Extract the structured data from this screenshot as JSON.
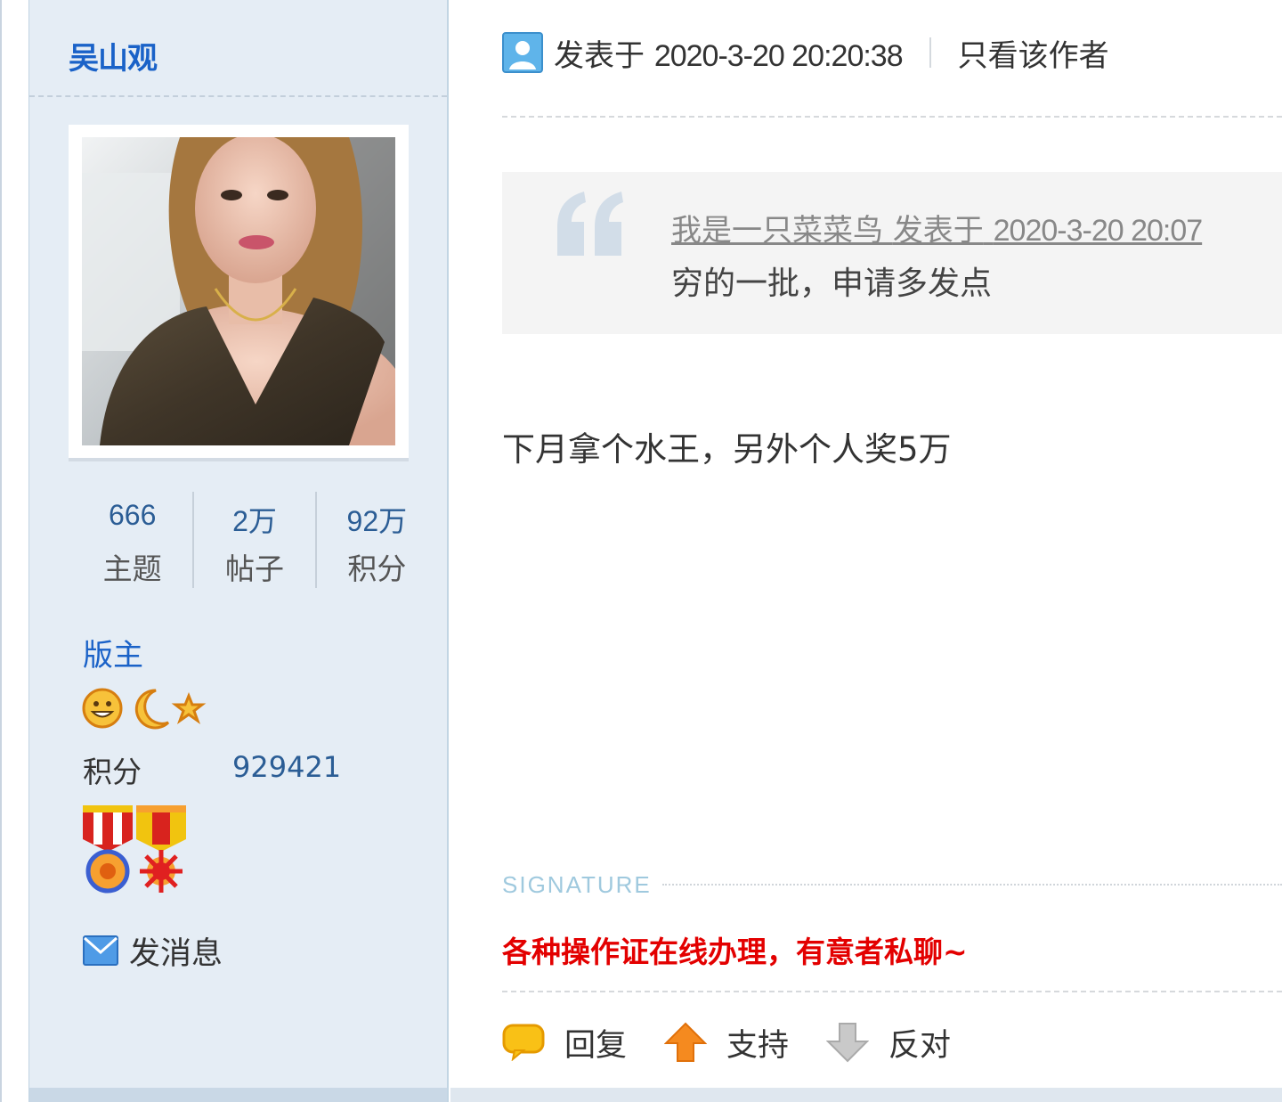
{
  "author": {
    "name": "吴山观",
    "stats": [
      {
        "value": "666",
        "label": "主题"
      },
      {
        "value": "2万",
        "label": "帖子"
      },
      {
        "value": "92万",
        "label": "积分"
      }
    ],
    "rank": "版主",
    "rank_icons": [
      "sun-icon",
      "moon-icon",
      "star-icon"
    ],
    "points_label": "积分",
    "points_value": "929421",
    "medals": [
      "medal-blue-icon",
      "medal-red-icon"
    ],
    "message_label": "发消息"
  },
  "post": {
    "posted_prefix": "发表于",
    "posted_time": "2020-3-20 20:20:38",
    "only_author_label": "只看该作者",
    "quote": {
      "user": "我是一只菜菜鸟",
      "posted_prefix": "发表于",
      "time": "2020-3-20 20:07",
      "text": "穷的一批，申请多发点"
    },
    "body": "下月拿个水王，另外个人奖5万",
    "signature_label": "SIGNATURE",
    "signature_text": "各种操作证在线办理，有意者私聊~",
    "actions": [
      {
        "icon": "reply-icon",
        "label": "回复"
      },
      {
        "icon": "support-arrow-up-icon",
        "label": "支持"
      },
      {
        "icon": "oppose-arrow-down-icon",
        "label": "反对"
      }
    ]
  },
  "colors": {
    "sidebar_bg": "#e5edf5",
    "link_blue": "#1a62c8",
    "stat_blue": "#2b5d95",
    "signature_red": "#e30000"
  }
}
